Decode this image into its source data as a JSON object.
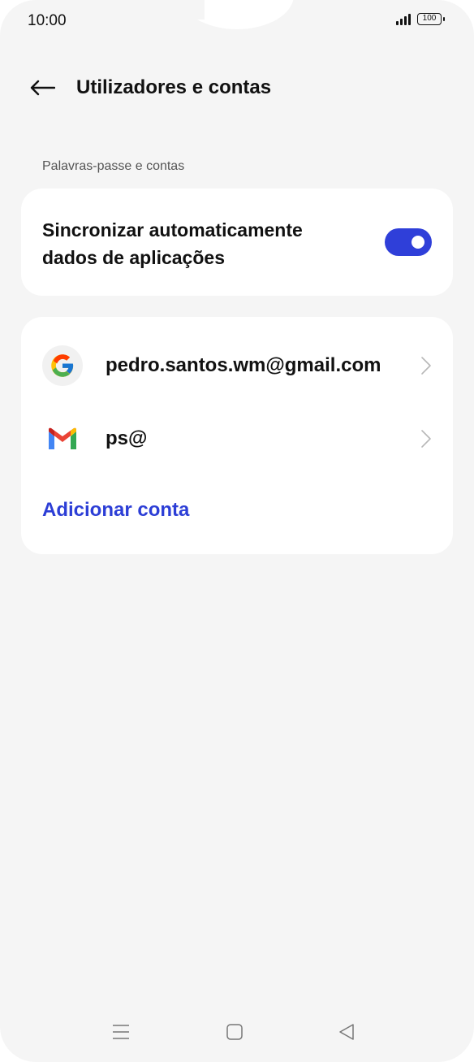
{
  "status_bar": {
    "time": "10:00",
    "battery": "100",
    "signal_icon": "signal-icon"
  },
  "header": {
    "back_icon": "arrow-left-icon",
    "title": "Utilizadores e contas"
  },
  "section": {
    "label": "Palavras-passe e contas"
  },
  "sync": {
    "label": "Sincronizar automaticamente dados de aplicações",
    "enabled": true,
    "accent": "#2f3fd9"
  },
  "accounts": [
    {
      "icon": "google-icon",
      "label": "pedro.santos.wm@gmail.com"
    },
    {
      "icon": "gmail-icon",
      "label": "ps@"
    }
  ],
  "add_account": {
    "label": "Adicionar conta",
    "color": "#2c3ed6"
  },
  "nav_bar": {
    "menu_icon": "menu-icon",
    "home_icon": "home-square-icon",
    "back_icon": "back-triangle-icon"
  }
}
